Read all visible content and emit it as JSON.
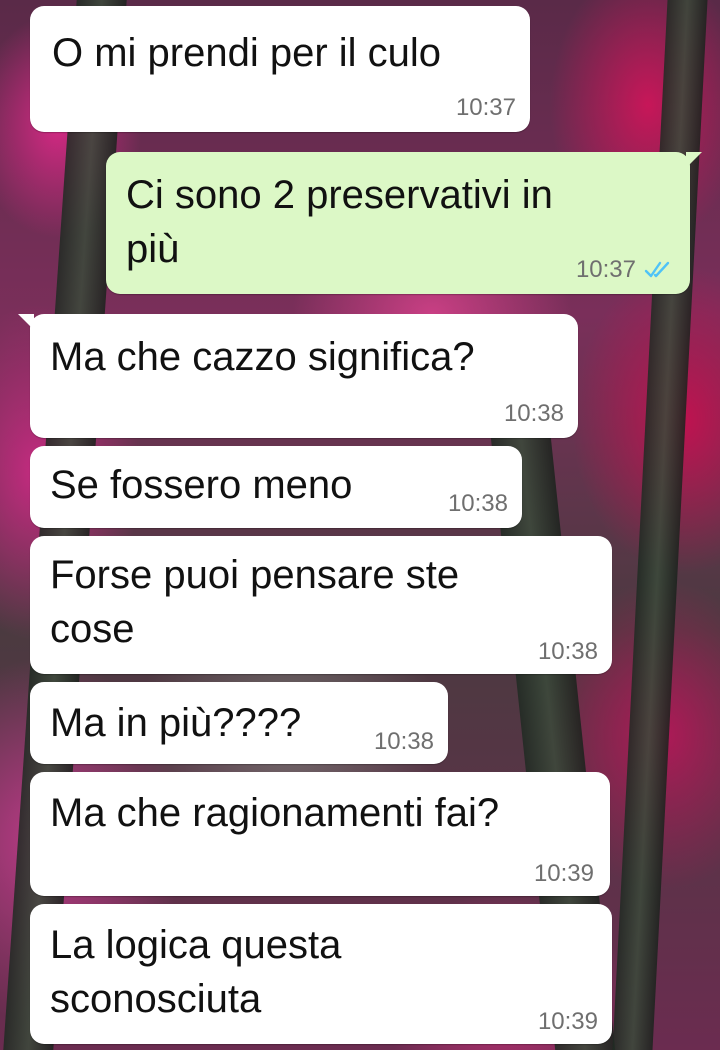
{
  "colors": {
    "incoming_bubble": "#ffffff",
    "outgoing_bubble": "#dcf8c6",
    "timestamp": "#6f6f6f",
    "read_ticks": "#4fc3f7"
  },
  "messages": [
    {
      "direction": "incoming",
      "text": "O mi prendi per il culo",
      "time": "10:37"
    },
    {
      "direction": "outgoing",
      "text": "Ci sono 2 preservativi in\npiù",
      "time": "10:37",
      "status_icon": "double-check-read-icon"
    },
    {
      "direction": "incoming",
      "text": "Ma che cazzo significa?",
      "time": "10:38"
    },
    {
      "direction": "incoming",
      "text": "Se fossero meno",
      "time": "10:38"
    },
    {
      "direction": "incoming",
      "text": "Forse puoi pensare ste\ncose",
      "time": "10:38"
    },
    {
      "direction": "incoming",
      "text": "Ma in più????",
      "time": "10:38"
    },
    {
      "direction": "incoming",
      "text": "Ma che ragionamenti fai?",
      "time": "10:39"
    },
    {
      "direction": "incoming",
      "text": "La logica questa\nsconosciuta",
      "time": "10:39"
    }
  ]
}
